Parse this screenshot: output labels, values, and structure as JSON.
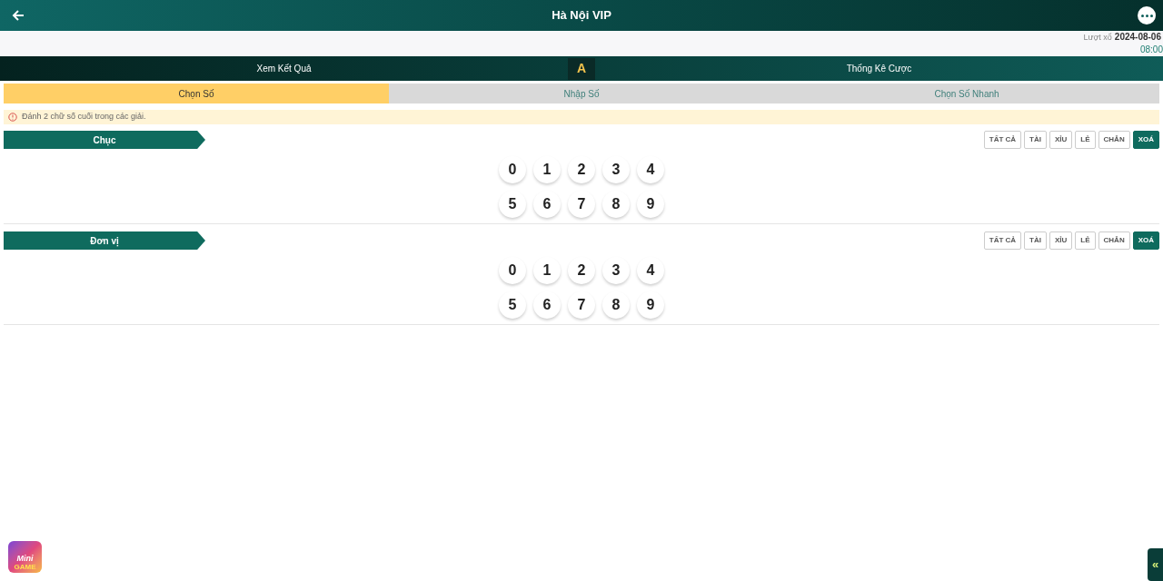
{
  "header": {
    "title": "Hà Nội VIP"
  },
  "draw_info": {
    "label": "Lượt xổ",
    "date": "2024-08-06",
    "time": "08:00"
  },
  "nav": {
    "left": "Xem Kết Quả",
    "center_icon": "A",
    "right": "Thống Kê Cược"
  },
  "tabs": [
    {
      "label": "Chọn Số",
      "selected": true
    },
    {
      "label": "Nhập Số",
      "selected": false
    },
    {
      "label": "Chọn Số Nhanh",
      "selected": false
    }
  ],
  "notice": "Đánh 2 chữ số cuối trong các giải.",
  "sections": [
    {
      "title": "Chục",
      "buttons": [
        {
          "label": "TẤT CẢ",
          "kind": "filter"
        },
        {
          "label": "TÀI",
          "kind": "filter"
        },
        {
          "label": "XỈU",
          "kind": "filter"
        },
        {
          "label": "LẺ",
          "kind": "filter"
        },
        {
          "label": "CHẴN",
          "kind": "filter"
        },
        {
          "label": "XOÁ",
          "kind": "clear"
        }
      ],
      "numbers": [
        {
          "label": "0",
          "selected": false
        },
        {
          "label": "1",
          "selected": false
        },
        {
          "label": "2",
          "selected": false
        },
        {
          "label": "3",
          "selected": false
        },
        {
          "label": "4",
          "selected": false
        },
        {
          "label": "5",
          "selected": false
        },
        {
          "label": "6",
          "selected": false
        },
        {
          "label": "7",
          "selected": false
        },
        {
          "label": "8",
          "selected": false
        },
        {
          "label": "9",
          "selected": false
        }
      ]
    },
    {
      "title": "Đơn vị",
      "buttons": [
        {
          "label": "TẤT CẢ",
          "kind": "filter"
        },
        {
          "label": "TÀI",
          "kind": "filter"
        },
        {
          "label": "XỈU",
          "kind": "filter"
        },
        {
          "label": "LẺ",
          "kind": "filter"
        },
        {
          "label": "CHẴN",
          "kind": "filter"
        },
        {
          "label": "XOÁ",
          "kind": "clear"
        }
      ],
      "numbers": [
        {
          "label": "0",
          "selected": false
        },
        {
          "label": "1",
          "selected": false
        },
        {
          "label": "2",
          "selected": false
        },
        {
          "label": "3",
          "selected": false
        },
        {
          "label": "4",
          "selected": false
        },
        {
          "label": "5",
          "selected": false
        },
        {
          "label": "6",
          "selected": false
        },
        {
          "label": "7",
          "selected": false
        },
        {
          "label": "8",
          "selected": false
        },
        {
          "label": "9",
          "selected": false
        }
      ]
    }
  ],
  "mini_game": {
    "line_1": "Mini",
    "line_2": "GAME"
  },
  "side_tab": {
    "glyph": "«"
  }
}
